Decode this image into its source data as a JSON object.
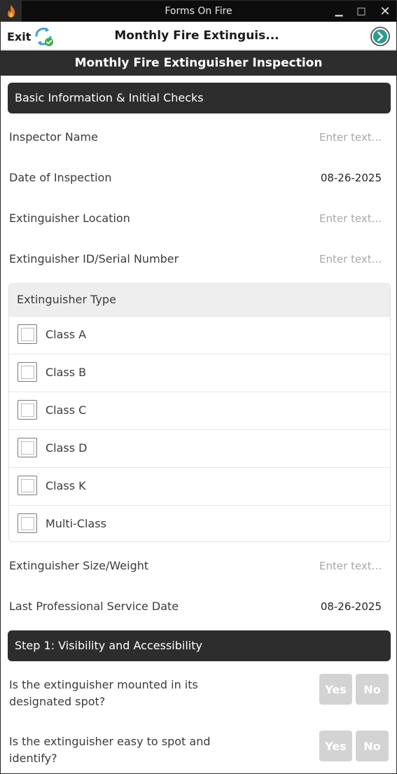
{
  "window": {
    "title": "Forms On Fire",
    "app_icon": "flame-icon",
    "minimize": "▁",
    "maximize": "□",
    "close": "✕"
  },
  "appbar": {
    "exit_label": "Exit",
    "sync_icon": "sync-check-icon",
    "title": "Monthly Fire Extinguis...",
    "next_icon": "chevron-right-circle-icon",
    "accent": "#2a9d8f"
  },
  "form": {
    "title": "Monthly Fire Extinguisher Inspection",
    "sections": [
      {
        "title": "Basic Information & Initial Checks",
        "fields": [
          {
            "label": "Inspector Name",
            "value": "",
            "placeholder": "Enter text..."
          },
          {
            "label": "Date of Inspection",
            "value": "08-26-2025",
            "placeholder": ""
          },
          {
            "label": "Extinguisher Location",
            "value": "",
            "placeholder": "Enter text..."
          },
          {
            "label": "Extinguisher ID/Serial Number",
            "value": "",
            "placeholder": "Enter text..."
          }
        ],
        "type_group": {
          "label": "Extinguisher Type",
          "options": [
            {
              "label": "Class A",
              "checked": false
            },
            {
              "label": "Class B",
              "checked": false
            },
            {
              "label": "Class C",
              "checked": false
            },
            {
              "label": "Class D",
              "checked": false
            },
            {
              "label": "Class K",
              "checked": false
            },
            {
              "label": "Multi-Class",
              "checked": false
            }
          ]
        },
        "fields_after": [
          {
            "label": "Extinguisher Size/Weight",
            "value": "",
            "placeholder": "Enter text..."
          },
          {
            "label": "Last Professional Service Date",
            "value": "08-26-2025",
            "placeholder": ""
          }
        ]
      },
      {
        "title": "Step 1: Visibility and Accessibility",
        "questions": [
          {
            "text": "Is the extinguisher mounted in its designated spot?",
            "yes": "Yes",
            "no": "No"
          },
          {
            "text": "Is the extinguisher easy to spot and identify?",
            "yes": "Yes",
            "no": "No"
          }
        ]
      }
    ]
  },
  "colors": {
    "header_dark": "#2d2d2d",
    "button_disabled": "#d3d3d3",
    "placeholder": "#a8a8a8"
  }
}
